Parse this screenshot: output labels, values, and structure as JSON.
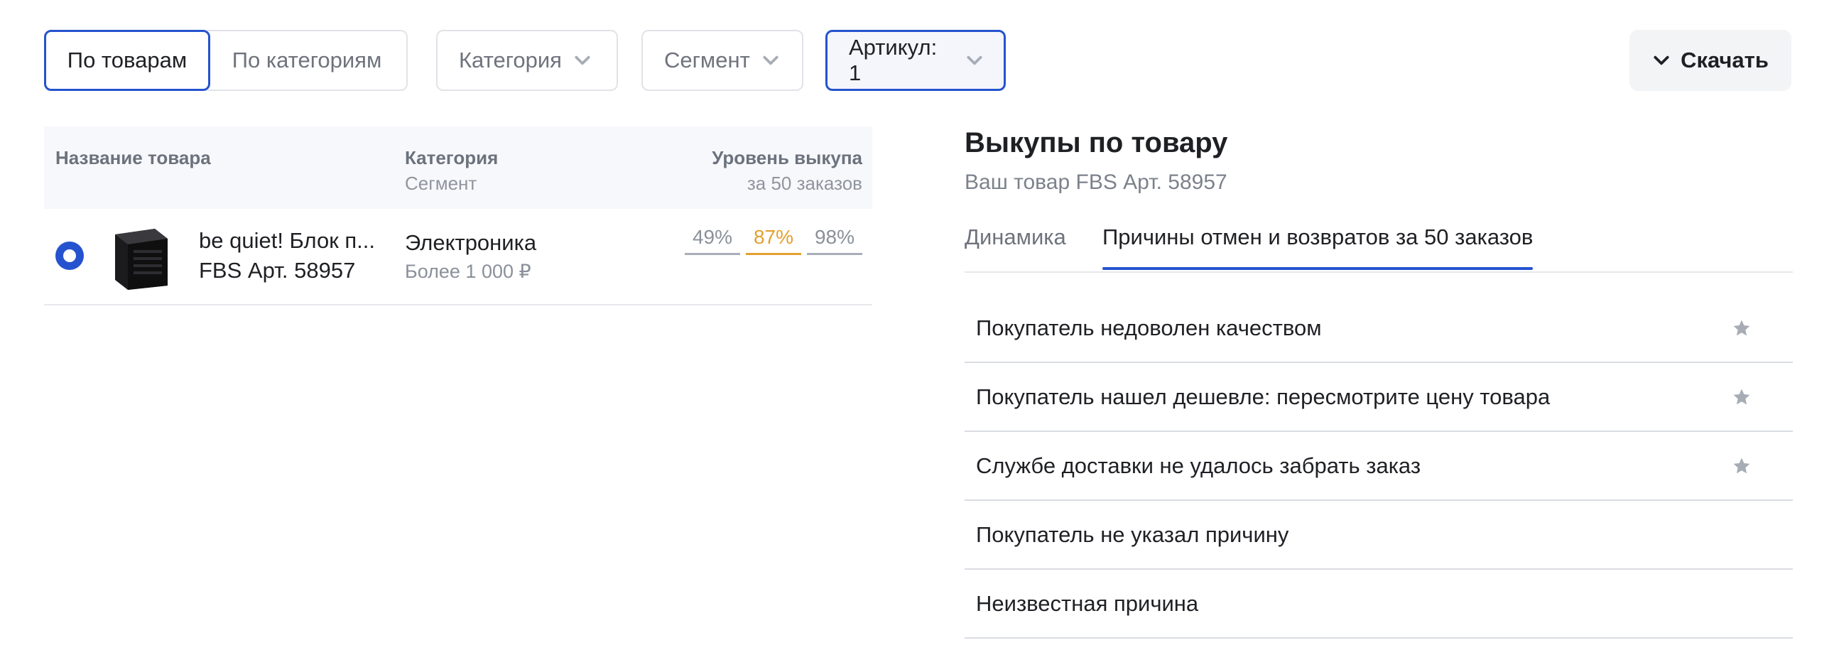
{
  "filters": {
    "seg_active": "По товарам",
    "seg_other": "По категориям",
    "category": "Категория",
    "segment": "Сегмент",
    "article": "Артикул: 1",
    "download": "Скачать"
  },
  "table": {
    "headers": {
      "name": "Название товара",
      "category": "Категория",
      "segment": "Сегмент",
      "level": "Уровень выкупа",
      "level_sub": "за 50 заказов"
    },
    "rows": [
      {
        "name": "be quiet! Блок п...",
        "article": "FBS Арт. 58957",
        "category": "Электроника",
        "segment": "Более 1 000 ₽",
        "levels": [
          "49%",
          "87%",
          "98%"
        ]
      }
    ]
  },
  "detail": {
    "title": "Выкупы по товару",
    "subtitle": "Ваш товар FBS Арт. 58957",
    "tabs": [
      "Динамика",
      "Причины отмен и возвратов за 50 заказов"
    ],
    "reasons": [
      {
        "text": "Покупатель недоволен качеством",
        "star": true
      },
      {
        "text": "Покупатель нашел дешевле: пересмотрите цену товара",
        "star": true
      },
      {
        "text": "Службе доставки не удалось забрать заказ",
        "star": true
      },
      {
        "text": "Покупатель не указал причину",
        "star": false
      },
      {
        "text": "Неизвестная причина",
        "star": false
      }
    ]
  },
  "colors": {
    "accent": "#2553cf",
    "warning": "#e59f2e",
    "muted": "#a9aeb8"
  },
  "icons": {
    "dropdown": "chevron-down-icon",
    "star": "star-icon",
    "download": "chevron-down-icon"
  }
}
